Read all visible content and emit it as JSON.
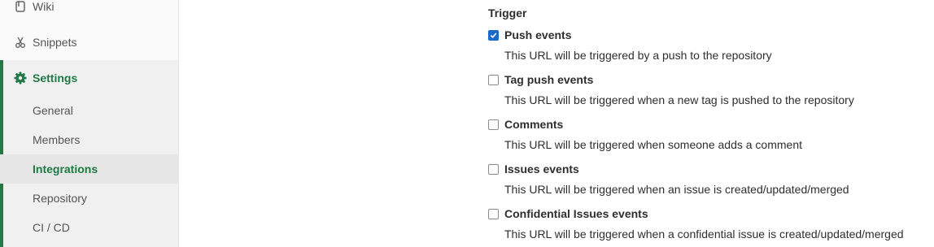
{
  "sidebar": {
    "wiki": {
      "label": "Wiki",
      "icon": "book-icon"
    },
    "snippets": {
      "label": "Snippets",
      "icon": "scissors-icon"
    },
    "settings": {
      "label": "Settings",
      "icon": "gear-icon"
    },
    "sub_items": [
      {
        "label": "General"
      },
      {
        "label": "Members"
      },
      {
        "label": "Integrations",
        "active": true
      },
      {
        "label": "Repository"
      },
      {
        "label": "CI / CD"
      }
    ]
  },
  "trigger": {
    "title": "Trigger",
    "items": [
      {
        "label": "Push events",
        "checked": true,
        "description": "This URL will be triggered by a push to the repository"
      },
      {
        "label": "Tag push events",
        "checked": false,
        "description": "This URL will be triggered when a new tag is pushed to the repository"
      },
      {
        "label": "Comments",
        "checked": false,
        "description": "This URL will be triggered when someone adds a comment"
      },
      {
        "label": "Issues events",
        "checked": false,
        "description": "This URL will be triggered when an issue is created/updated/merged"
      },
      {
        "label": "Confidential Issues events",
        "checked": false,
        "description": "This URL will be triggered when a confidential issue is created/updated/merged"
      }
    ]
  },
  "colors": {
    "accent": "#1f7a45",
    "checkbox_checked": "#1b6ac9"
  }
}
